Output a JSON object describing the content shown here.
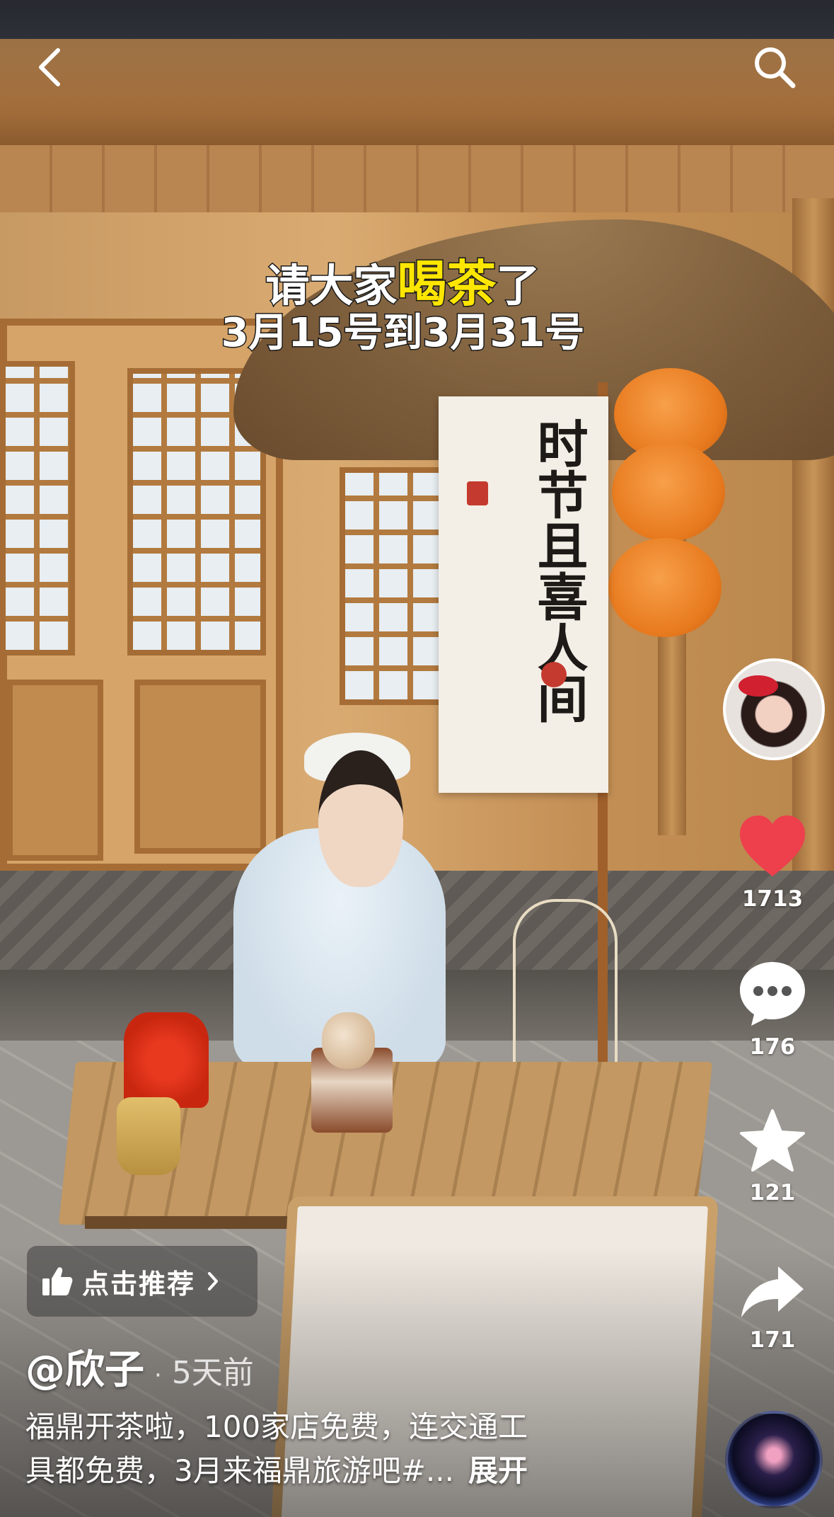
{
  "caption": {
    "line1_before": "请大家",
    "line1_highlight": "喝茶",
    "line1_after": "了",
    "line2": "3月15号到3月31号"
  },
  "banner": {
    "col1": "时节",
    "col2": "且喜人间"
  },
  "actions": {
    "likes": "1713",
    "comments": "176",
    "favorites": "121",
    "shares": "171"
  },
  "recommend_label": "点击推荐",
  "author": "@欣子",
  "separator": "·",
  "time_ago": "5天前",
  "description": {
    "line1": "福鼎开茶啦，100家店免费，连交通工",
    "line2": "具都免费，3月来福鼎旅游吧#...",
    "expand": "展开"
  },
  "colors": {
    "like": "#ee3f4d",
    "highlight": "#ffe600"
  },
  "icons": [
    "back-arrow-icon",
    "search-icon",
    "heart-icon",
    "comment-icon",
    "star-icon",
    "share-icon",
    "thumbs-up-icon",
    "chevron-right-icon"
  ]
}
